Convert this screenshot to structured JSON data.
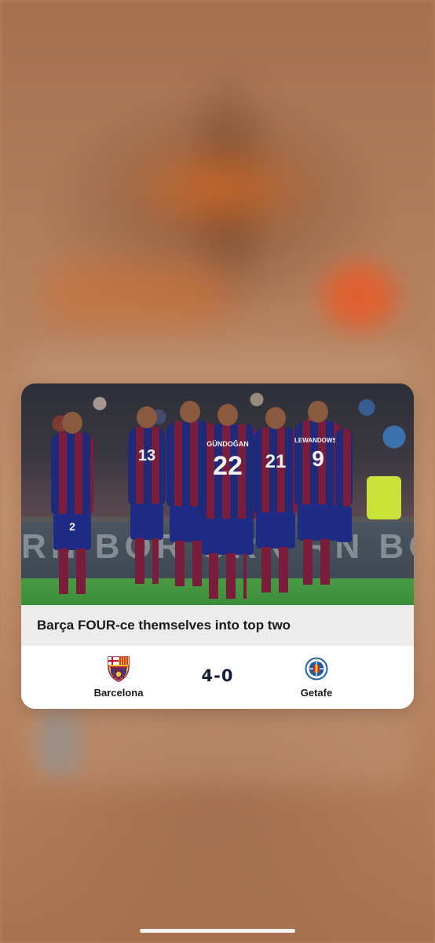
{
  "notification": {
    "image_alt": "Barcelona players celebrating",
    "ad_board_text": "RN BOR   ORN   RN BO",
    "headline": "Barça FOUR-ce themselves into top two",
    "match": {
      "home_team": "Barcelona",
      "home_crest_icon": "fc-barcelona-crest-icon",
      "away_team": "Getafe",
      "away_crest_icon": "getafe-crest-icon",
      "score": "4-0"
    },
    "players": [
      {
        "number": "2"
      },
      {
        "number": "13"
      },
      {
        "number": "22",
        "name": "GÜNDOĞAN"
      },
      {
        "number": "21"
      },
      {
        "number": "9",
        "name": "LEWANDOWSKI"
      }
    ]
  },
  "colors": {
    "barca_blue": "#1f2a7a",
    "barca_garnet": "#7a1d3a",
    "score_text": "#142033",
    "headline_bar": "#ececec"
  }
}
